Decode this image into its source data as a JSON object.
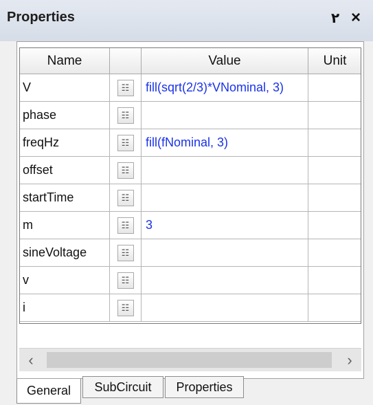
{
  "window": {
    "title": "Properties",
    "pin_glyph": "٢",
    "close_glyph": "×"
  },
  "grid": {
    "columns": [
      "Name",
      "",
      "Value",
      "Unit"
    ],
    "button_glyph": "☷",
    "rows": [
      {
        "name": "V",
        "value": "fill(sqrt(2/3)*VNominal, 3)",
        "unit": ""
      },
      {
        "name": "phase",
        "value": "",
        "unit": ""
      },
      {
        "name": "freqHz",
        "value": "fill(fNominal, 3)",
        "unit": ""
      },
      {
        "name": "offset",
        "value": "",
        "unit": ""
      },
      {
        "name": "startTime",
        "value": "",
        "unit": ""
      },
      {
        "name": "m",
        "value": "3",
        "unit": ""
      },
      {
        "name": "sineVoltage",
        "value": "",
        "unit": ""
      },
      {
        "name": "v",
        "value": "",
        "unit": ""
      },
      {
        "name": "i",
        "value": "",
        "unit": ""
      }
    ]
  },
  "scrollbar": {
    "left_glyph": "‹",
    "right_glyph": "›"
  },
  "tabs": [
    {
      "label": "General",
      "active": true
    },
    {
      "label": "SubCircuit",
      "active": false
    },
    {
      "label": "Properties",
      "active": false
    }
  ],
  "colors": {
    "value_text": "#1a33e6",
    "title_bar": "#dce2eb"
  }
}
